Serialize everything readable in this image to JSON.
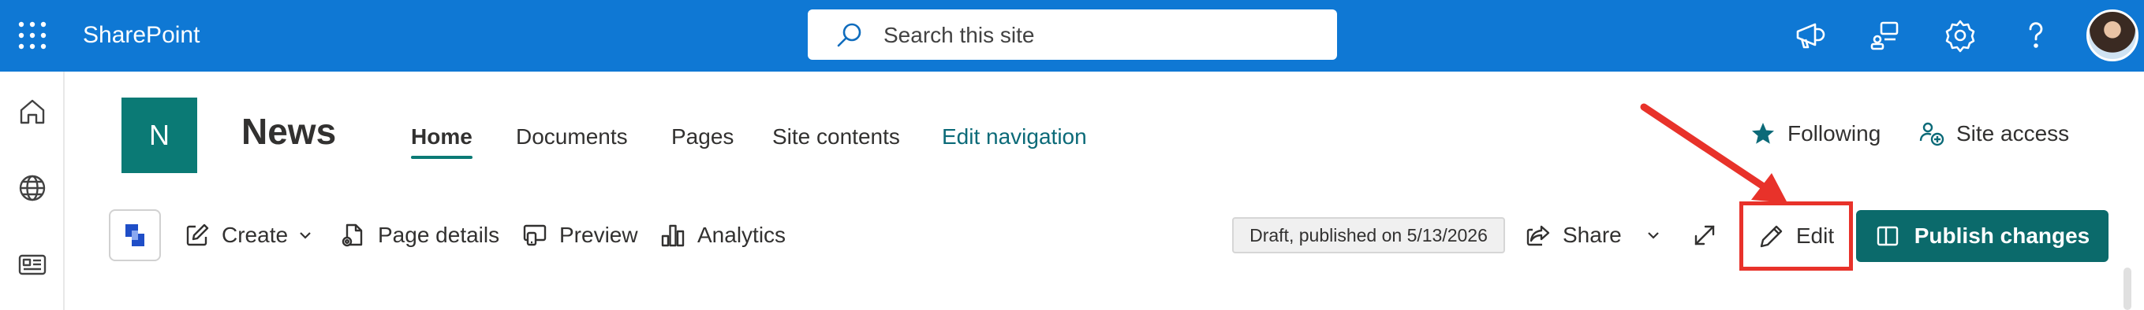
{
  "suitebar": {
    "app_name": "SharePoint",
    "search_placeholder": "Search this site",
    "icons": [
      "app-launcher-icon",
      "megaphone-icon",
      "feed-icon",
      "settings-icon",
      "help-icon"
    ],
    "brand_color": "#0f78d4"
  },
  "leftbar": {
    "items": [
      "home-icon",
      "globe-icon",
      "news-icon"
    ]
  },
  "site": {
    "logo_letter": "N",
    "title": "News",
    "accent_color": "#0b7a75",
    "nav": [
      {
        "label": "Home",
        "active": true
      },
      {
        "label": "Documents"
      },
      {
        "label": "Pages"
      },
      {
        "label": "Site contents"
      },
      {
        "label": "Edit navigation"
      }
    ],
    "following_label": "Following",
    "site_access_label": "Site access"
  },
  "commandbar": {
    "create_label": "Create",
    "page_details_label": "Page details",
    "preview_label": "Preview",
    "analytics_label": "Analytics",
    "status": "Draft, published on 5/13/2026",
    "share_label": "Share",
    "edit_label": "Edit",
    "publish_label": "Publish changes",
    "publish_color": "#0b6a6b",
    "highlight_color": "#e8322a"
  }
}
